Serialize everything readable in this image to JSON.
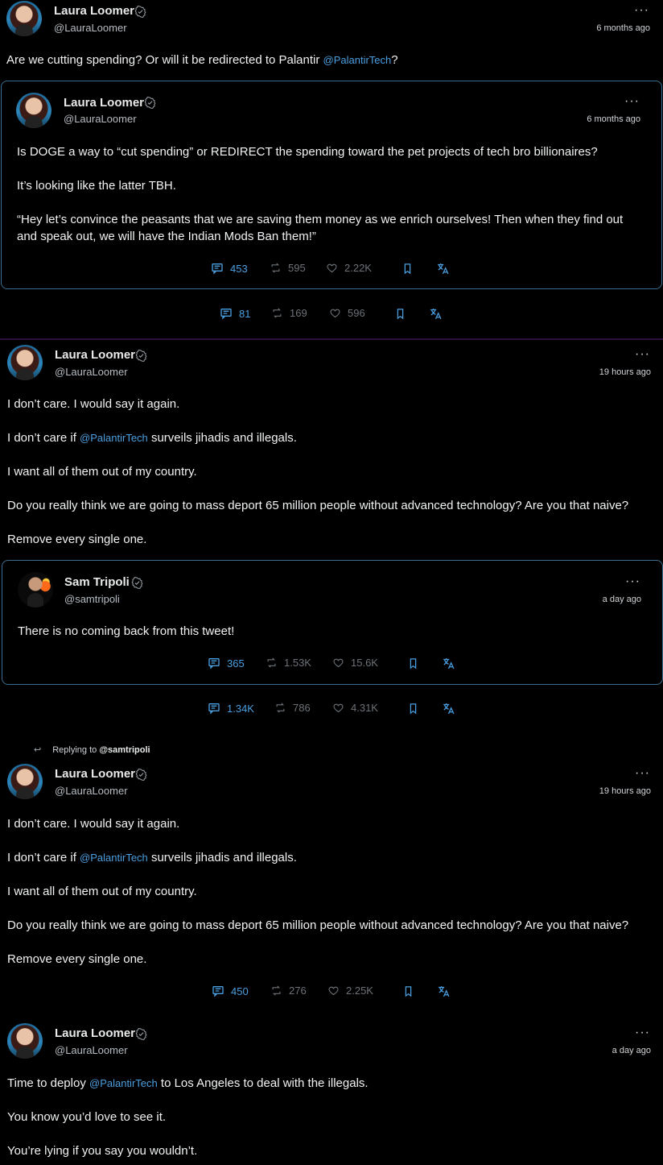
{
  "tweet1": {
    "author": "Laura Loomer",
    "handle": "@LauraLoomer",
    "time": "6 months ago",
    "text_before": "Are we cutting spending? Or will it be redirected to Palantir ",
    "mention": "@PalantirTech",
    "text_after": "?",
    "quote": {
      "author": "Laura Loomer",
      "handle": "@LauraLoomer",
      "time": "6 months ago",
      "line1": "Is DOGE a way to “cut spending” or REDIRECT the spending toward the pet projects of tech bro billionaires?",
      "line2": "It’s looking like the latter TBH.",
      "line3": "“Hey let’s convince the peasants that we are saving them money as we enrich ourselves! Then when they find out",
      "line4": "and speak out, we will have the Indian Mods Ban them!”",
      "replies": "453",
      "retweets": "595",
      "likes": "2.22K"
    },
    "replies": "81",
    "retweets": "169",
    "likes": "596"
  },
  "tweet2": {
    "author": "Laura Loomer",
    "handle": "@LauraLoomer",
    "time": "19 hours ago",
    "line1": "I don’t care. I would say it again.",
    "line2_before": "I don’t care if ",
    "mention": "@PalantirTech",
    "line2_after": " surveils jihadis and illegals.",
    "line3": "I want all of them out of my country.",
    "line4": "Do you really think we are going to mass deport 65 million people without advanced technology? Are you that naive?",
    "line5": "Remove every single one.",
    "quote": {
      "author": "Sam Tripoli",
      "handle": "@samtripoli",
      "time": "a day ago",
      "text": "There is no coming back from this tweet!",
      "replies": "365",
      "retweets": "1.53K",
      "likes": "15.6K"
    },
    "replies": "1.34K",
    "retweets": "786",
    "likes": "4.31K"
  },
  "tweet3": {
    "replying_label": "Replying to ",
    "replying_to": "@samtripoli",
    "author": "Laura Loomer",
    "handle": "@LauraLoomer",
    "time": "19 hours ago",
    "line1": "I don’t care. I would say it again.",
    "line2_before": "I don’t care if ",
    "mention": "@PalantirTech",
    "line2_after": " surveils jihadis and illegals.",
    "line3": "I want all of them out of my country.",
    "line4": "Do you really think we are going to mass deport 65 million people without advanced technology? Are you that naive?",
    "line5": "Remove every single one.",
    "replies": "450",
    "retweets": "276",
    "likes": "2.25K"
  },
  "tweet4": {
    "author": "Laura Loomer",
    "handle": "@LauraLoomer",
    "time": "a day ago",
    "line1_before": "Time to deploy ",
    "mention": "@PalantirTech",
    "line1_after": " to Los Angeles to deal with the illegals.",
    "line2": "You know you’d love to see it.",
    "line3": "You’re lying if you say you wouldn’t."
  },
  "more_label": "···",
  "colors": {
    "accent": "#4a9fe0",
    "muted": "#6c7278",
    "quote_border": "#3a6d8f",
    "divider": "#2a0f3a"
  }
}
